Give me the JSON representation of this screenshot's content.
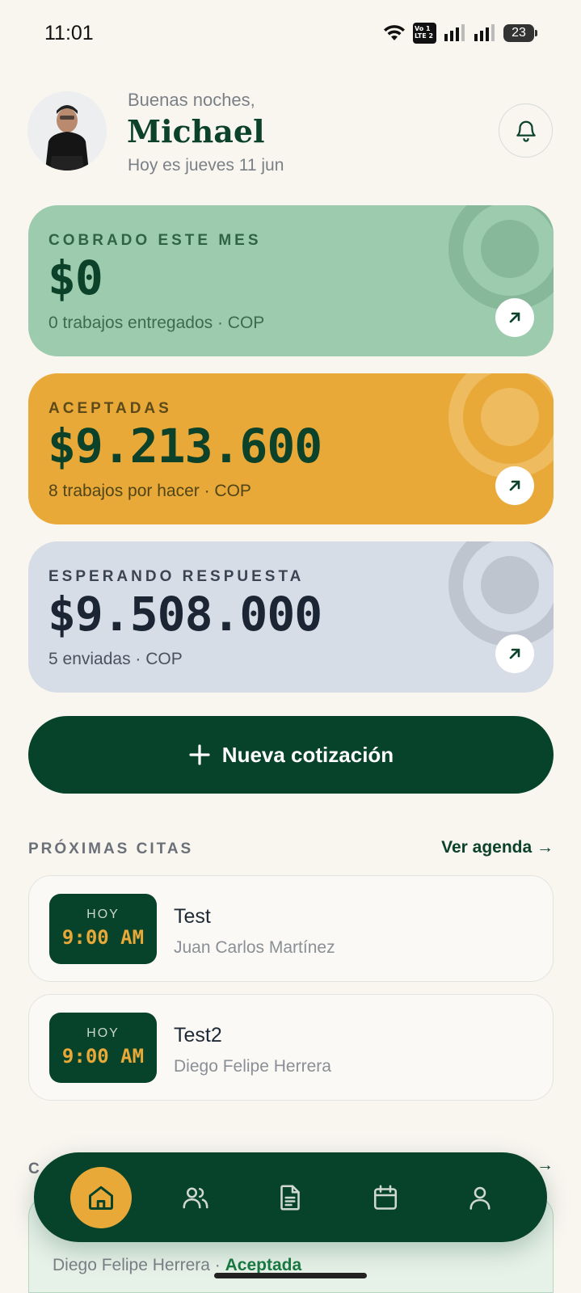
{
  "status_bar": {
    "time": "11:01",
    "volte_line1": "Vo 1",
    "volte_line2": "LTE 2",
    "battery": "23"
  },
  "header": {
    "greeting": "Buenas noches,",
    "name": "Michael",
    "date": "Hoy es jueves 11 jun"
  },
  "cards": [
    {
      "label": "COBRADO ESTE MES",
      "amount": "$0",
      "subtitle": "0 trabajos entregados · COP",
      "color": "#9dcbae"
    },
    {
      "label": "ACEPTADAS",
      "amount": "$9.213.600",
      "subtitle": "8 trabajos por hacer · COP",
      "color": "#e8a938"
    },
    {
      "label": "ESPERANDO RESPUESTA",
      "amount": "$9.508.000",
      "subtitle": "5 enviadas · COP",
      "color": "#d6dde6"
    }
  ],
  "cta": {
    "icon": "plus-icon",
    "label": "Nueva cotización"
  },
  "appointments": {
    "title": "PRÓXIMAS CITAS",
    "link": "Ver agenda →",
    "items": [
      {
        "day": "HOY",
        "time": "9:00 AM",
        "title": "Test",
        "person": "Juan Carlos Martínez"
      },
      {
        "day": "HOY",
        "time": "9:00 AM",
        "title": "Test2",
        "person": "Diego Felipe Herrera"
      }
    ]
  },
  "recent": {
    "title_visible": "C",
    "link_visible": "→",
    "person": "Diego Felipe Herrera",
    "separator": " · ",
    "status": "Aceptada"
  },
  "nav": [
    {
      "icon": "home-icon",
      "active": true
    },
    {
      "icon": "users-icon",
      "active": false
    },
    {
      "icon": "document-icon",
      "active": false
    },
    {
      "icon": "calendar-icon",
      "active": false
    },
    {
      "icon": "profile-icon",
      "active": false
    }
  ],
  "colors": {
    "background": "#f9f6f0",
    "primary": "#07422a",
    "accent": "#e8a938"
  }
}
